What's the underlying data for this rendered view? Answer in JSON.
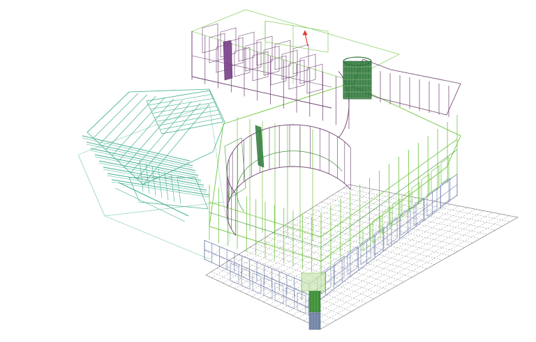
{
  "model": {
    "components": [
      "ground-grid",
      "left-wing",
      "base-tier",
      "middle-tier",
      "upper-tier",
      "curved-wall",
      "cylinder-tower",
      "front-column",
      "axis-marker"
    ]
  },
  "colors": {
    "background": "#ffffff",
    "grid": "#7d7d7d",
    "base": "#6f7fa8",
    "base_fill": "#7486a8",
    "middle": "#6cc43c",
    "middle_dark": "#3f8f3a",
    "upper": "#6b3d6e",
    "wing": "#3fae8f",
    "wing_light": "#8fd0b5",
    "tower": "#2e7a3a",
    "tower_dark": "#245f2e",
    "accent": "#e53935"
  }
}
